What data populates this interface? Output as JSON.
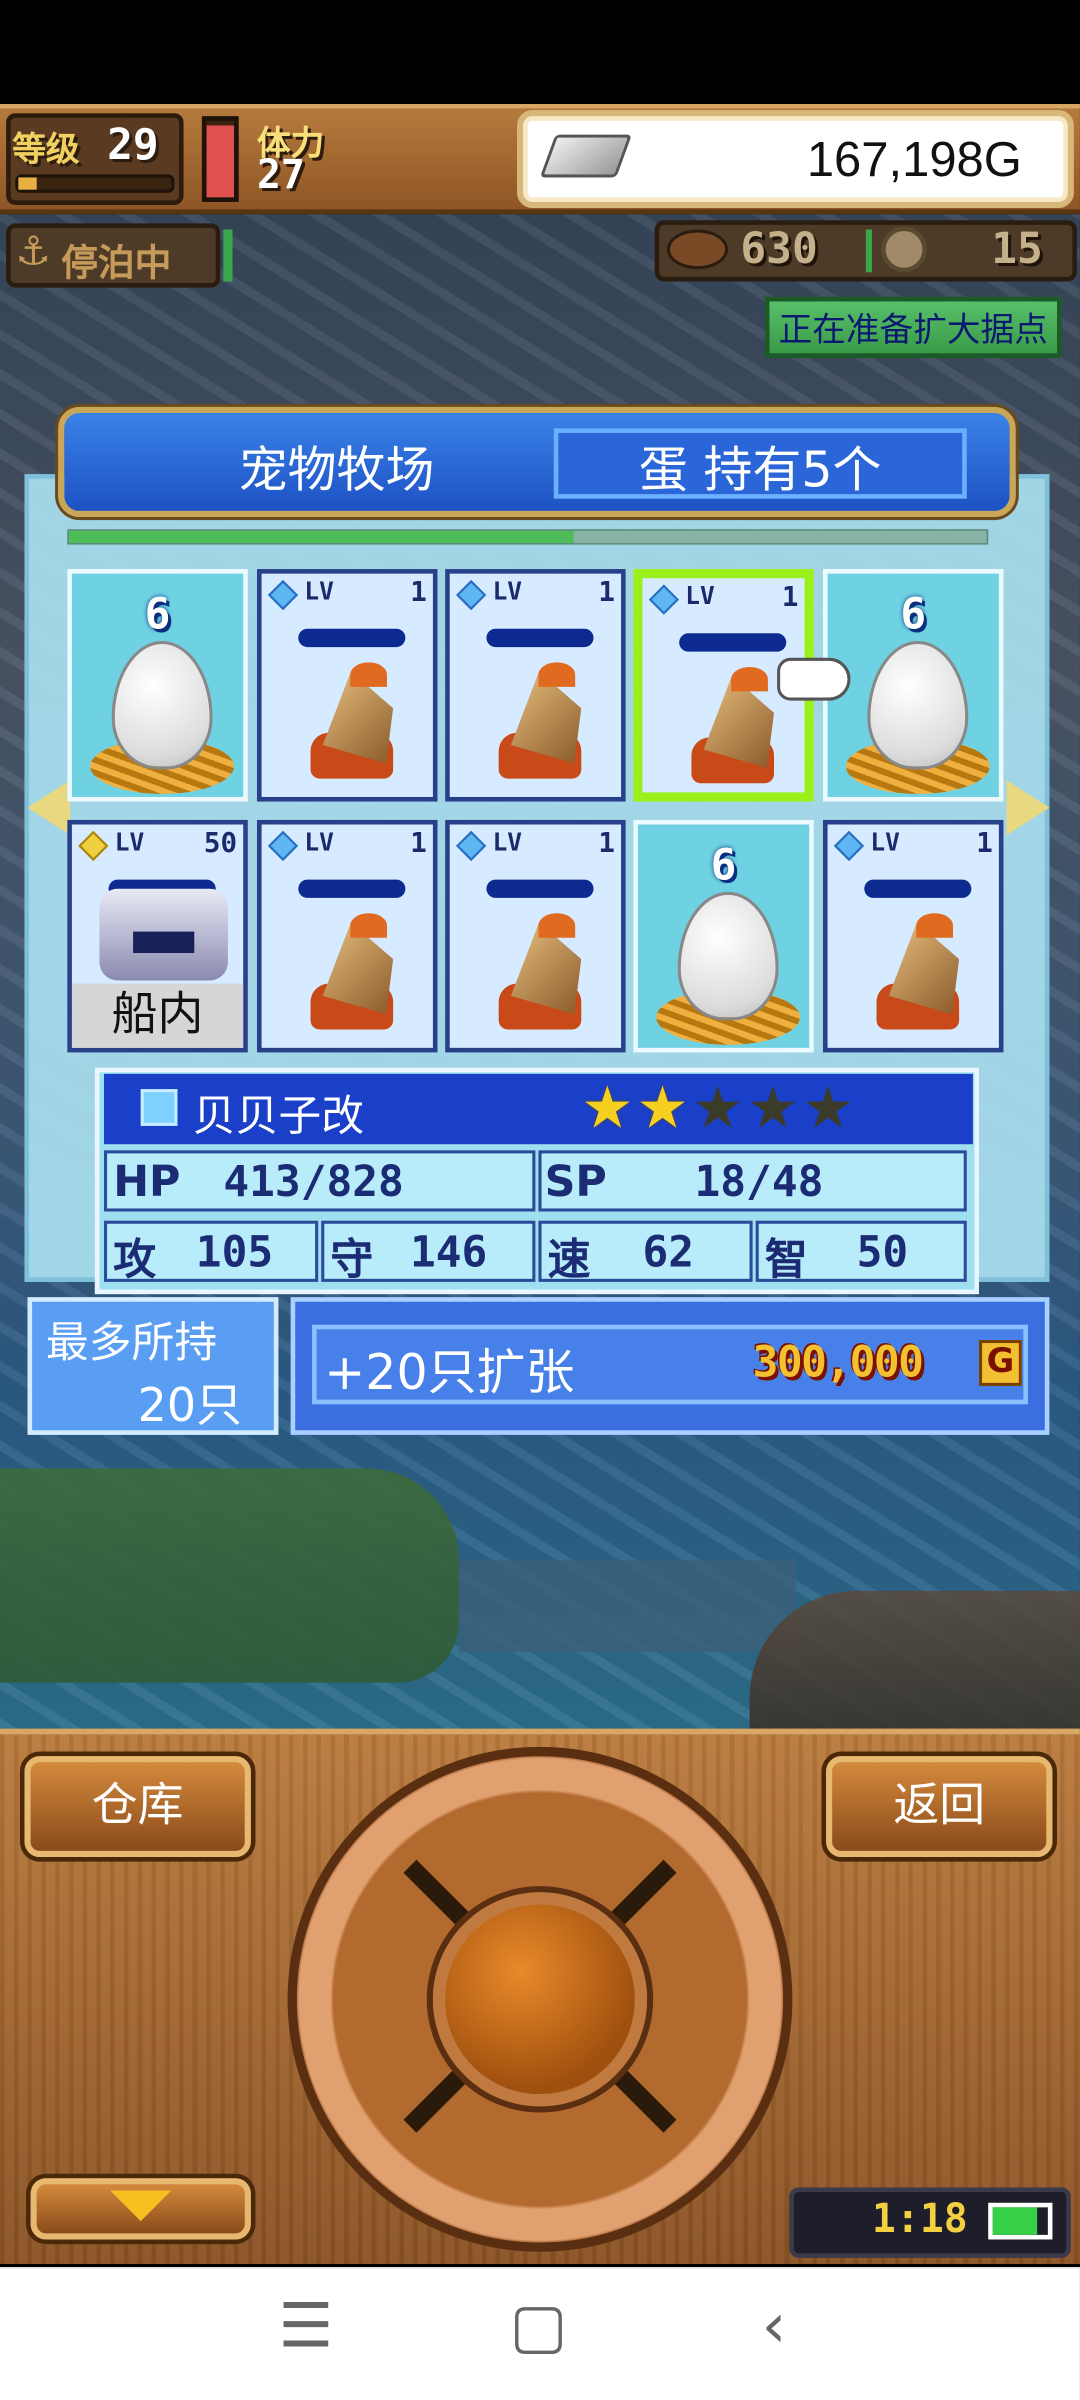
{
  "hud": {
    "level_label": "等级",
    "level": "29",
    "exp_fraction": 0.12,
    "stamina_label": "体力",
    "stamina": "27",
    "stamina_fraction": 0.95,
    "gold": "167,198G",
    "status": "停泊中",
    "food": "630",
    "medals": "15",
    "notice": "正在准备扩大据点"
  },
  "panel": {
    "title": "宠物牧场",
    "egg_info": "蛋 持有5个",
    "progress_fraction": 0.55,
    "cells": [
      {
        "type": "egg",
        "number": "6"
      },
      {
        "type": "pet",
        "lv_label": "LV",
        "level": "1"
      },
      {
        "type": "pet",
        "lv_label": "LV",
        "level": "1"
      },
      {
        "type": "pet",
        "lv_label": "LV",
        "level": "1",
        "selected": true
      },
      {
        "type": "egg",
        "number": "6"
      },
      {
        "type": "robot",
        "lv_label": "LV",
        "level": "50",
        "tag": "船内"
      },
      {
        "type": "pet",
        "lv_label": "LV",
        "level": "1"
      },
      {
        "type": "pet",
        "lv_label": "LV",
        "level": "1"
      },
      {
        "type": "egg",
        "number": "6"
      },
      {
        "type": "pet",
        "lv_label": "LV",
        "level": "1"
      }
    ]
  },
  "info": {
    "name": "贝贝子改",
    "stars_total": 5,
    "stars_filled": 2,
    "hp_label": "HP",
    "hp": "413/828",
    "sp_label": "SP",
    "sp": "18/48",
    "atk_label": "攻",
    "atk": "105",
    "def_label": "守",
    "def": "146",
    "spd_label": "速",
    "spd": "62",
    "int_label": "智",
    "int": "50"
  },
  "capacity": {
    "label": "最多所持",
    "value": "20只"
  },
  "expand": {
    "label": "+20只扩张",
    "price": "300,000",
    "currency": "G"
  },
  "buttons": {
    "warehouse": "仓库",
    "back": "返回"
  },
  "clock": "1:18",
  "battery_fraction": 0.8,
  "colors": {
    "accent_blue": "#1d52c4",
    "panel_bg": "#aae1f0",
    "select_green": "#9cf01a",
    "wood": "#b97a3c"
  },
  "icons": {
    "anchor": "anchor-icon",
    "ingot": "silver-ingot-icon",
    "food": "meat-icon",
    "coin": "coin-icon",
    "star": "star-icon",
    "hand": "pointer-hand-icon"
  }
}
